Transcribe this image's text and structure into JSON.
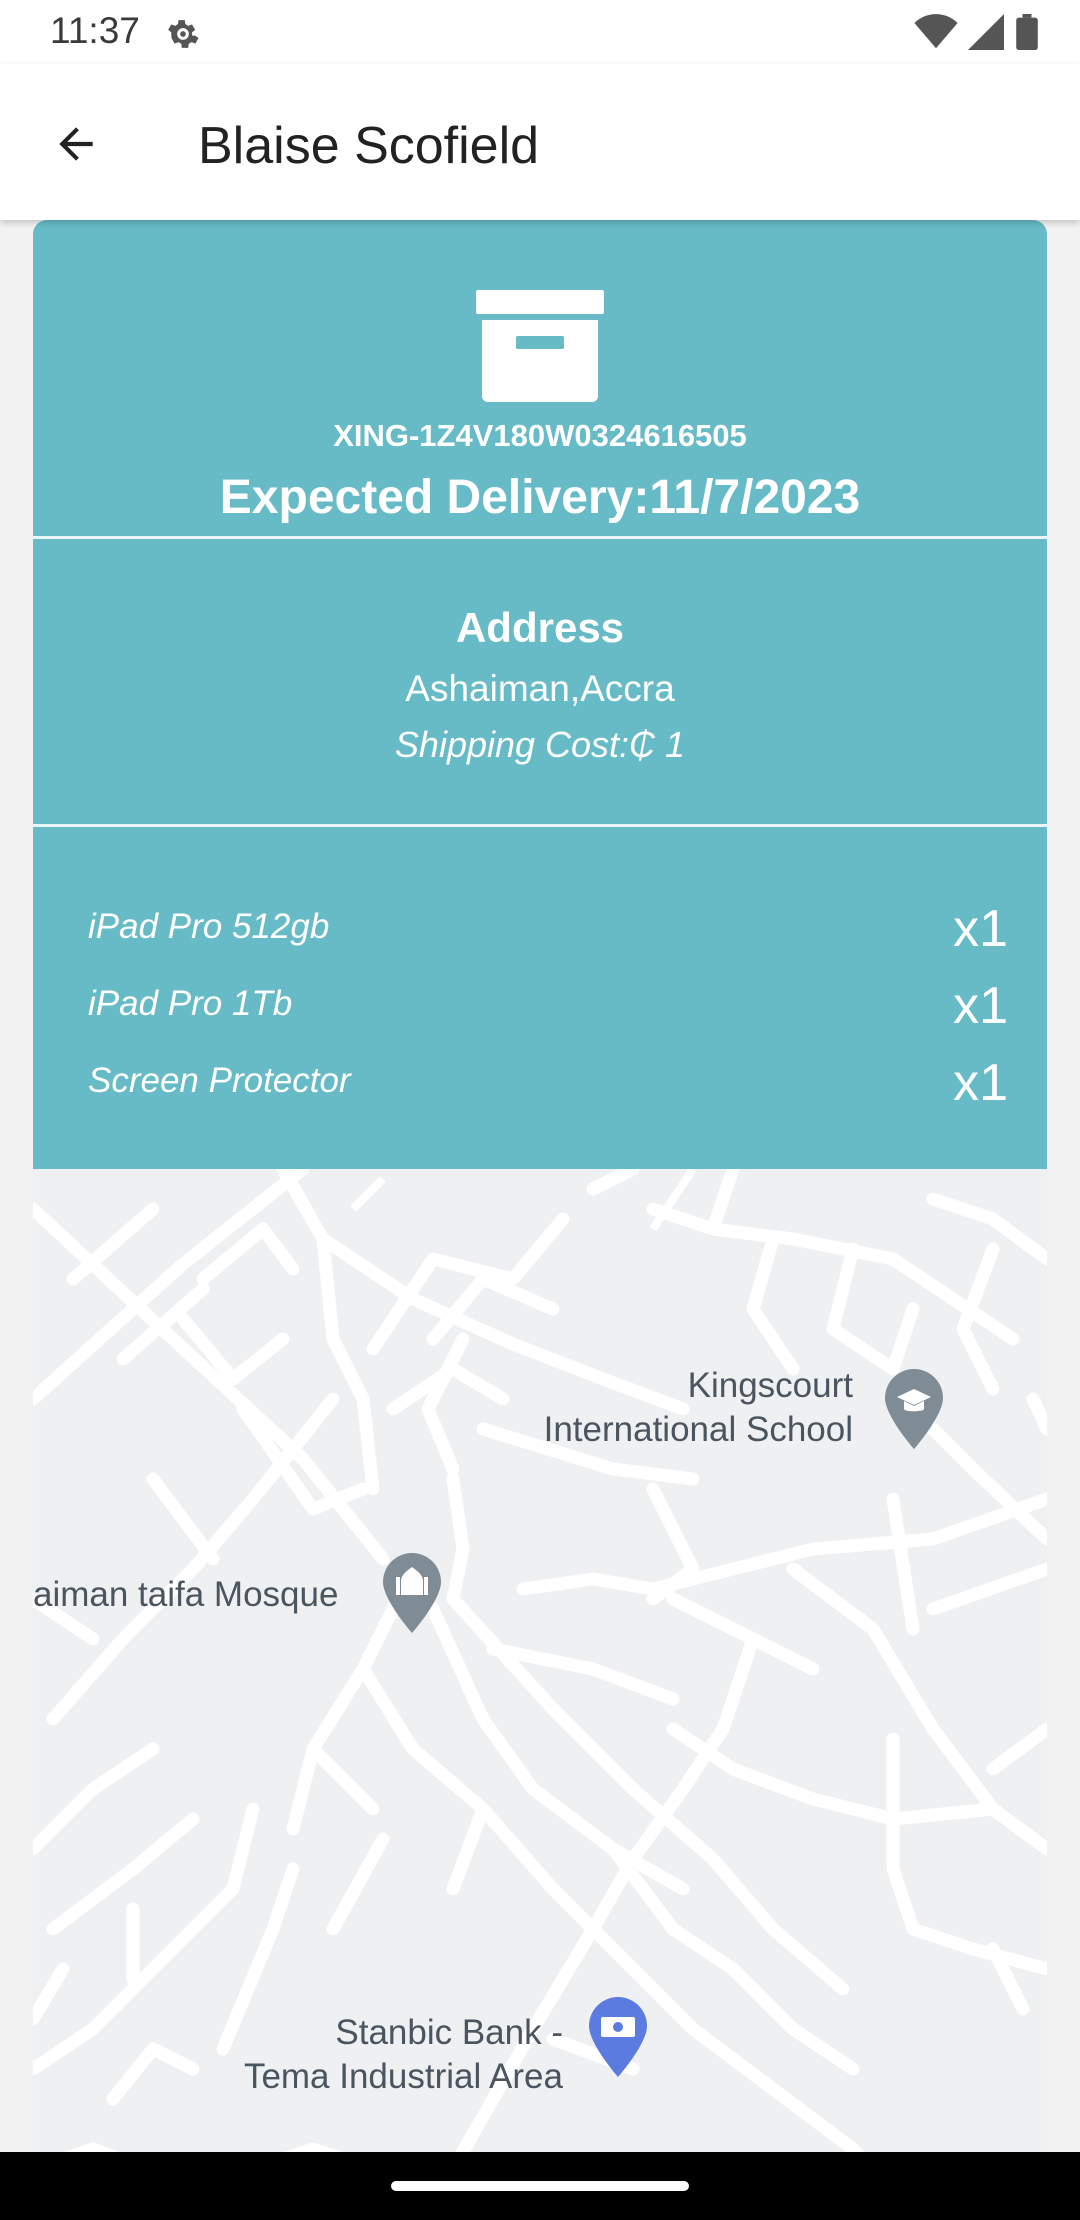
{
  "status_bar": {
    "time": "11:37"
  },
  "app_bar": {
    "title": "Blaise Scofield",
    "back_icon": "arrow-back-icon"
  },
  "shipment": {
    "tracking_number": "XING-1Z4V180W0324616505",
    "expected_delivery_label": "Expected Delivery:",
    "expected_delivery_date": "11/7/2023",
    "address_heading": "Address",
    "address": "Ashaiman,Accra",
    "shipping_cost": "Shipping Cost:₵ 1"
  },
  "items": [
    {
      "name": "iPad Pro 512gb",
      "qty": "x1"
    },
    {
      "name": "iPad Pro 1Tb",
      "qty": "x1"
    },
    {
      "name": "Screen Protector",
      "qty": "x1"
    }
  ],
  "map": {
    "labels": [
      {
        "text_line1": "Kingscourt",
        "text_line2": "International School",
        "icon": "school-pin-icon"
      },
      {
        "text_line1": "aiman taifa Mosque",
        "icon": "mosque-pin-icon"
      },
      {
        "text_line1": "Stanbic Bank -",
        "text_line2": "Tema Industrial Area",
        "icon": "bank-pin-icon"
      }
    ]
  },
  "colors": {
    "card": "#66bbc6",
    "map_bg": "#eff0f2",
    "pin": "#7f8c96"
  }
}
